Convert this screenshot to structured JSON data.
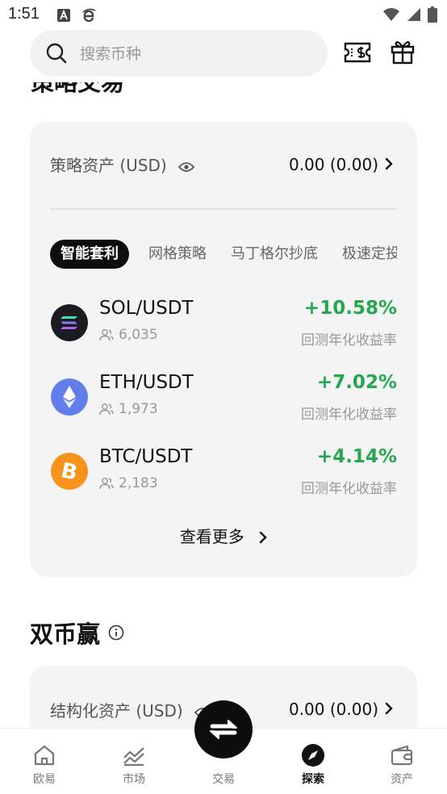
{
  "status_bar": {
    "time": "1:51"
  },
  "search": {
    "placeholder": "搜索币种"
  },
  "strategy": {
    "section_title": "策略交易",
    "asset_label": "策略资产 (USD)",
    "asset_value": "0.00 (0.00)",
    "tabs": [
      {
        "label": "智能套利",
        "active": true
      },
      {
        "label": "网格策略",
        "active": false
      },
      {
        "label": "马丁格尔抄底",
        "active": false
      },
      {
        "label": "极速定投",
        "active": false
      }
    ],
    "pairs": [
      {
        "name": "SOL/USDT",
        "users": "6,035",
        "rate": "+10.58%",
        "rate_label": "回测年化收益率",
        "icon": "sol-icon",
        "color": "#1b1b22"
      },
      {
        "name": "ETH/USDT",
        "users": "1,973",
        "rate": "+7.02%",
        "rate_label": "回测年化收益率",
        "icon": "eth-icon",
        "color": "#627eea"
      },
      {
        "name": "BTC/USDT",
        "users": "2,183",
        "rate": "+4.14%",
        "rate_label": "回测年化收益率",
        "icon": "btc-icon",
        "color": "#f7931a"
      }
    ],
    "see_more": "查看更多"
  },
  "dual": {
    "section_title": "双币赢",
    "asset_label": "结构化资产 (USD)",
    "asset_value": "0.00 (0.00)"
  },
  "bottom_nav": {
    "items": [
      {
        "label": "欧易",
        "icon": "home-icon",
        "active": false
      },
      {
        "label": "市场",
        "icon": "market-chart-icon",
        "active": false
      },
      {
        "label": "交易",
        "icon": "trade-swap-icon",
        "active": false
      },
      {
        "label": "探索",
        "icon": "compass-icon",
        "active": true
      },
      {
        "label": "资产",
        "icon": "wallet-icon",
        "active": false
      }
    ]
  },
  "colors": {
    "positive": "#25a750",
    "card_bg": "#f4f4f4",
    "primary": "#0d0d0d"
  }
}
